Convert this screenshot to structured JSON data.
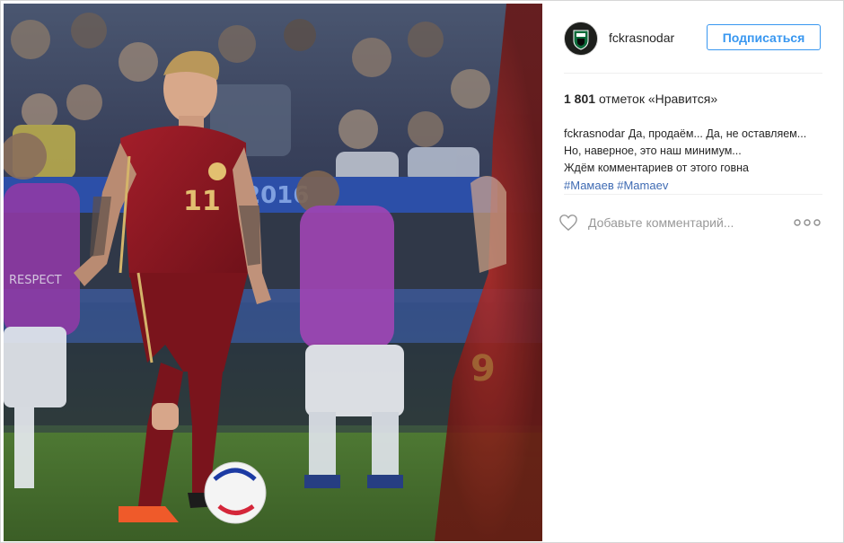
{
  "post": {
    "username": "fckrasnodar",
    "follow_label": "Подписаться",
    "likes_count": "1 801",
    "likes_label": "отметок «Нравится»",
    "caption": {
      "author": "fckrasnodar",
      "lines": [
        "Да, продаём... Да, не оставляем...",
        "Но, наверное, это наш минимум...",
        "Ждём комментариев от этого говна"
      ],
      "hashtags": [
        "#Мамаев",
        "#Mamaev"
      ]
    },
    "comment_placeholder": "Добавьте комментарий...",
    "icons": {
      "like": "heart-outline-icon",
      "options": "ellipsis-icon",
      "avatar": "club-crest-icon"
    },
    "photo": {
      "jersey_number": "11",
      "banner_text": "2016",
      "bib_text": "RESPECT"
    }
  },
  "colors": {
    "accent": "#3897f0",
    "hashtag": "#3f6bb3",
    "text": "#262626",
    "muted": "#999999",
    "divider": "#efefef"
  }
}
